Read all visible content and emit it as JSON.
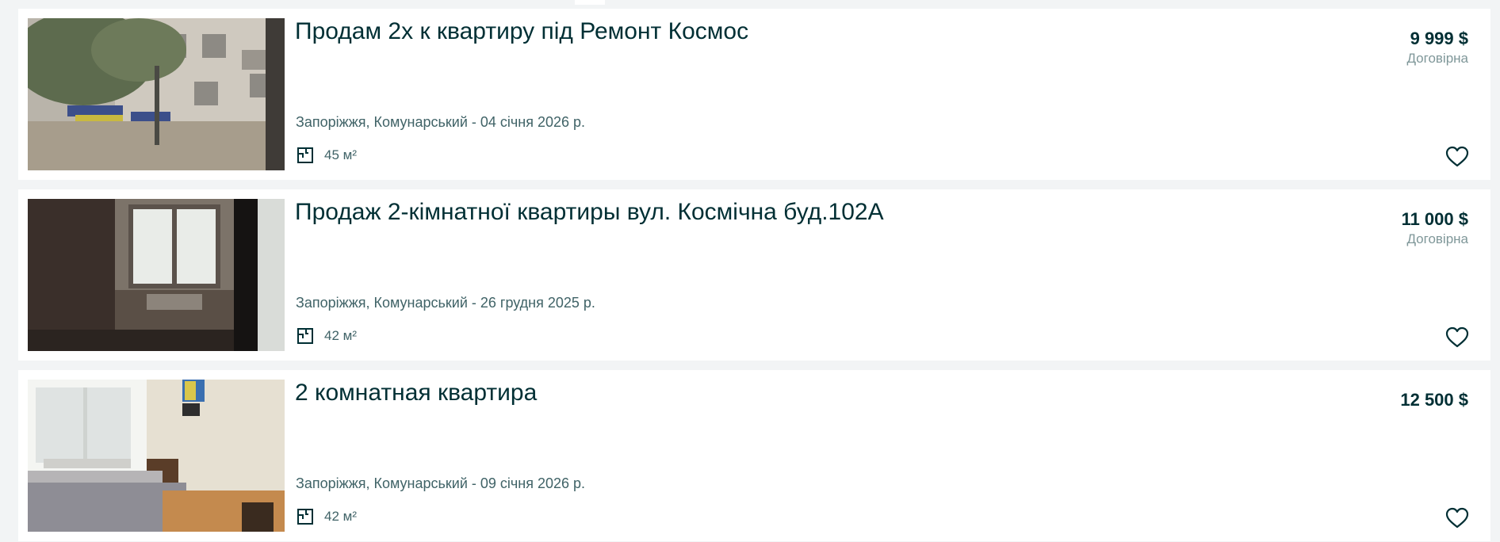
{
  "listings": [
    {
      "title": "Продам 2х к квартиру під Ремонт Космос",
      "location_date": "Запоріжжя, Комунарський - 04 січня 2026 р.",
      "area": "45 м²",
      "price": "9 999 $",
      "negotiable": "Договірна"
    },
    {
      "title": "Продаж 2-кімнатної квартиры вул. Космічна буд.102А",
      "location_date": "Запоріжжя, Комунарський - 26 грудня 2025 р.",
      "area": "42 м²",
      "price": "11 000 $",
      "negotiable": "Договірна"
    },
    {
      "title": "2 комнатная квартира",
      "location_date": "Запоріжжя, Комунарський - 09 січня 2026 р.",
      "area": "42 м²",
      "price": "12 500 $",
      "negotiable": ""
    }
  ],
  "colors": {
    "background": "#f2f4f5",
    "card": "#ffffff",
    "title": "#002f34",
    "secondary_text": "#406367",
    "negotiable_text": "#7f9799"
  },
  "icons": {
    "area": "floor-plan-icon",
    "favorite": "heart-outline-icon"
  }
}
